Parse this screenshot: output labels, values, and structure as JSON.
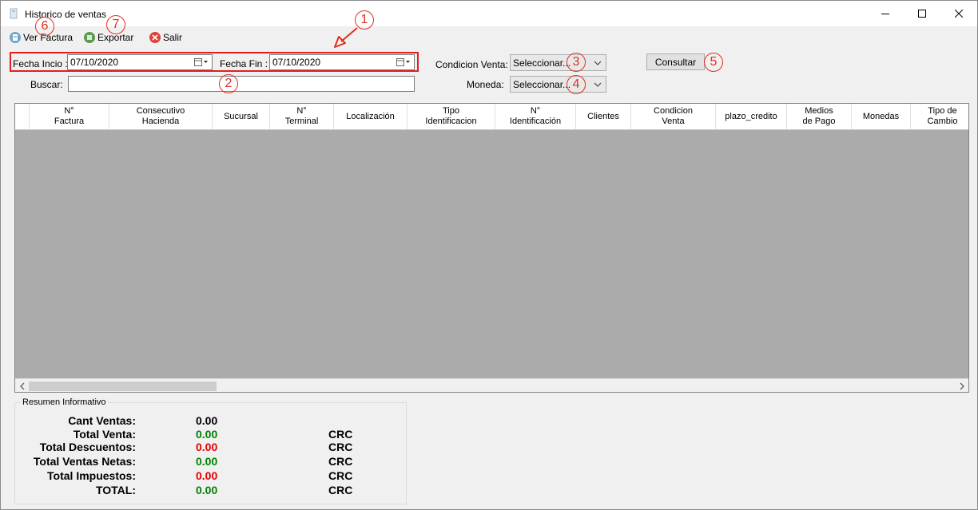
{
  "window": {
    "title": "Historico de ventas"
  },
  "toolbar": {
    "ver_factura": "Ver Factura",
    "exportar": "Exportar",
    "salir": "Salir"
  },
  "filters": {
    "fecha_inicio_label": "Fecha Incio :",
    "fecha_inicio_value": "07/10/2020",
    "fecha_fin_label": "Fecha Fin :",
    "fecha_fin_value": "07/10/2020",
    "buscar_label": "Buscar:",
    "buscar_value": "",
    "condicion_label": "Condicion Venta:",
    "condicion_value": "Seleccionar...",
    "moneda_label": "Moneda:",
    "moneda_value": "Seleccionar...",
    "consultar_label": "Consultar"
  },
  "annotations": [
    "1",
    "2",
    "3",
    "4",
    "5",
    "6",
    "7"
  ],
  "grid": {
    "columns": [
      "N°\nFactura",
      "Consecutivo\nHacienda",
      "Sucursal",
      "N°\nTerminal",
      "Localización",
      "Tipo\nIdentificacion",
      "N°\nIdentificación",
      "Clientes",
      "Condicion\nVenta",
      "plazo_credito",
      "Medios\nde Pago",
      "Monedas",
      "Tipo de\nCambio"
    ]
  },
  "summary": {
    "legend": "Resumen Informativo",
    "rows": [
      {
        "label": "Cant Ventas:",
        "value": "0.00",
        "currency": "",
        "color": "#000000"
      },
      {
        "label": "Total Venta:",
        "value": "0.00",
        "currency": "CRC",
        "color": "#008000"
      },
      {
        "label": "Total Descuentos:",
        "value": "0.00",
        "currency": "CRC",
        "color": "#e00000"
      },
      {
        "label": "Total Ventas Netas:",
        "value": "0.00",
        "currency": "CRC",
        "color": "#008000"
      },
      {
        "label": "Total Impuestos:",
        "value": "0.00",
        "currency": "CRC",
        "color": "#e00000"
      },
      {
        "label": "TOTAL:",
        "value": "0.00",
        "currency": "CRC",
        "color": "#008000"
      }
    ]
  },
  "colors": {
    "grid_bg": "#ababab",
    "annotation": "#e03020"
  }
}
